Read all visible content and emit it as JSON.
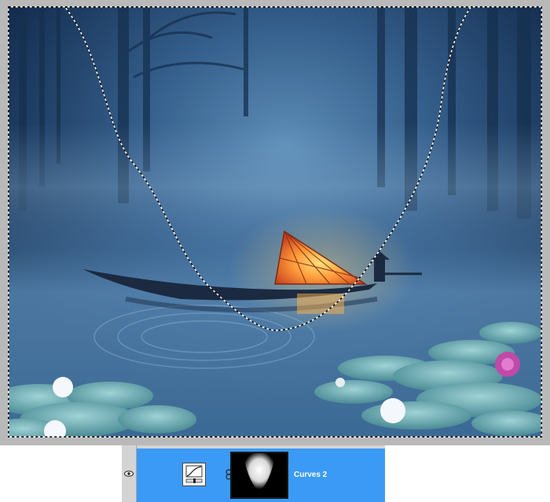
{
  "layers_panel": {
    "layer": {
      "name": "Curves 2",
      "type": "curves adjustment layer",
      "visible": true,
      "selected": true
    },
    "icons": {
      "visibility": "eye-icon",
      "adjustment": "curves-icon",
      "link": "chain-link-icon",
      "mask": "layer-mask-thumbnail"
    },
    "colors": {
      "selected_row": "#3c9af7",
      "panel_bg": "#d4d4d4"
    }
  },
  "canvas": {
    "has_selection": true,
    "selection_style": "marching-ants"
  }
}
